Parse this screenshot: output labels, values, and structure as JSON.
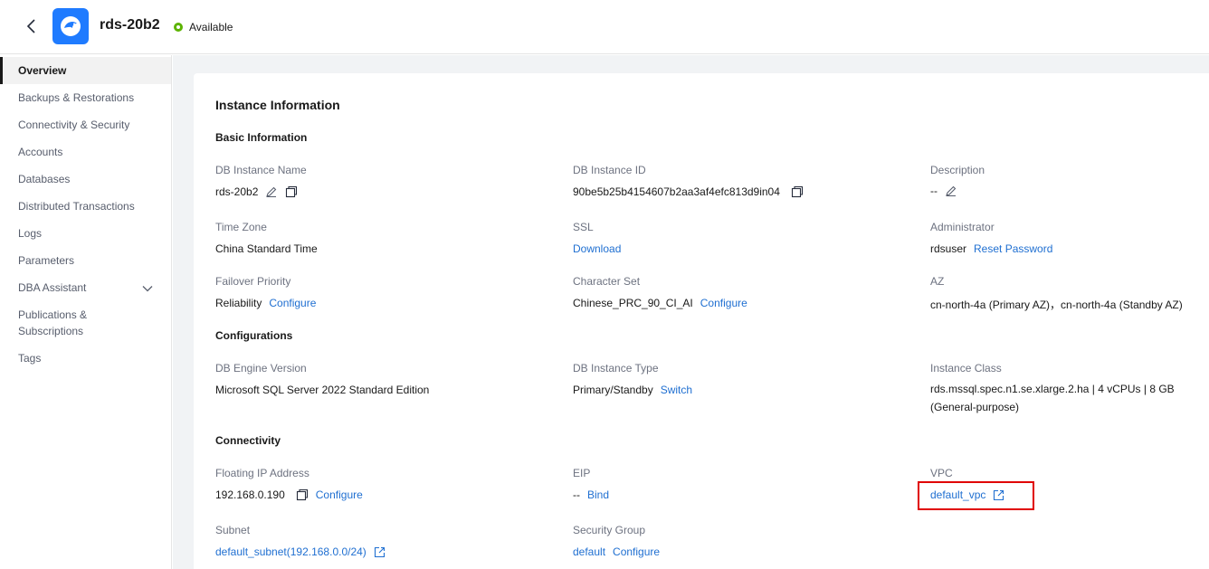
{
  "header": {
    "title": "rds-20b2",
    "status": "Available",
    "back_icon": "chevron-left-icon",
    "logo_icon": "rds-dolphin-logo",
    "colors": {
      "brand": "#1f7bff",
      "status": "#5cb300",
      "link": "#1f6fd1",
      "highlight": "#e00000"
    }
  },
  "sidebar": {
    "items": [
      {
        "label": "Overview",
        "active": true
      },
      {
        "label": "Backups & Restorations"
      },
      {
        "label": "Connectivity & Security"
      },
      {
        "label": "Accounts"
      },
      {
        "label": "Databases"
      },
      {
        "label": "Distributed Transactions"
      },
      {
        "label": "Logs"
      },
      {
        "label": "Parameters"
      },
      {
        "label": "DBA Assistant",
        "expandable": true
      },
      {
        "label_line1": "Publications &",
        "label_line2": "Subscriptions"
      },
      {
        "label": "Tags"
      }
    ]
  },
  "main": {
    "title": "Instance Information",
    "basic": {
      "title": "Basic Information",
      "db_instance_name": {
        "label": "DB Instance Name",
        "value": "rds-20b2"
      },
      "db_instance_id": {
        "label": "DB Instance ID",
        "value": "90be5b25b4154607b2aa3af4efc813d9in04"
      },
      "description": {
        "label": "Description",
        "value": "--"
      },
      "time_zone": {
        "label": "Time Zone",
        "value": "China Standard Time"
      },
      "ssl": {
        "label": "SSL",
        "link": "Download"
      },
      "administrator": {
        "label": "Administrator",
        "value": "rdsuser",
        "link": "Reset Password"
      },
      "failover": {
        "label": "Failover Priority",
        "value": "Reliability",
        "link": "Configure"
      },
      "charset": {
        "label": "Character Set",
        "value": "Chinese_PRC_90_CI_AI",
        "link": "Configure"
      },
      "az": {
        "label": "AZ",
        "value": "cn-north-4a (Primary AZ)，cn-north-4a (Standby AZ)"
      }
    },
    "configurations": {
      "title": "Configurations",
      "engine": {
        "label": "DB Engine Version",
        "value": "Microsoft SQL Server 2022 Standard Edition"
      },
      "type": {
        "label": "DB Instance Type",
        "value": "Primary/Standby",
        "link": "Switch"
      },
      "class": {
        "label": "Instance Class",
        "value_line1": "rds.mssql.spec.n1.se.xlarge.2.ha | 4 vCPUs | 8 GB",
        "value_line2": "(General-purpose)"
      }
    },
    "connectivity": {
      "title": "Connectivity",
      "floating_ip": {
        "label": "Floating IP Address",
        "value": "192.168.0.190",
        "link": "Configure"
      },
      "eip": {
        "label": "EIP",
        "value": "--",
        "link": "Bind"
      },
      "vpc": {
        "label": "VPC",
        "link": "default_vpc"
      },
      "subnet": {
        "label": "Subnet",
        "link": "default_subnet(192.168.0.0/24)"
      },
      "security_group": {
        "label": "Security Group",
        "value": "default",
        "link": "Configure"
      }
    }
  }
}
